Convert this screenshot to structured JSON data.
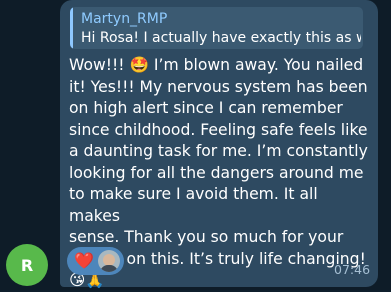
{
  "avatar": {
    "initial": "R",
    "color": "#58b94b"
  },
  "message": {
    "reply": {
      "author": "Martyn_RMP",
      "text": "Hi Rosa! I actually have exactly this as well…"
    },
    "body": "Wow!!! 🤩 I’m blown away. You nailed\nit! Yes!!! My nervous system has been\non high alert since I can remember\nsince childhood. Feeling safe feels like\na daunting task for me. I’m constantly\nlooking for all the dangers around me\nto make sure I avoid  them. It all makes\nsense. Thank you so much for your\ninsight on this. It’s truly life changing!\n😘🙏",
    "reaction": {
      "emoji": "❤️",
      "icon": "heart-icon"
    },
    "time": "07:46"
  },
  "colors": {
    "bubble": "#2e4a61",
    "reply_accent": "#8ec8ff",
    "reaction_pill": "#4d86bb"
  }
}
